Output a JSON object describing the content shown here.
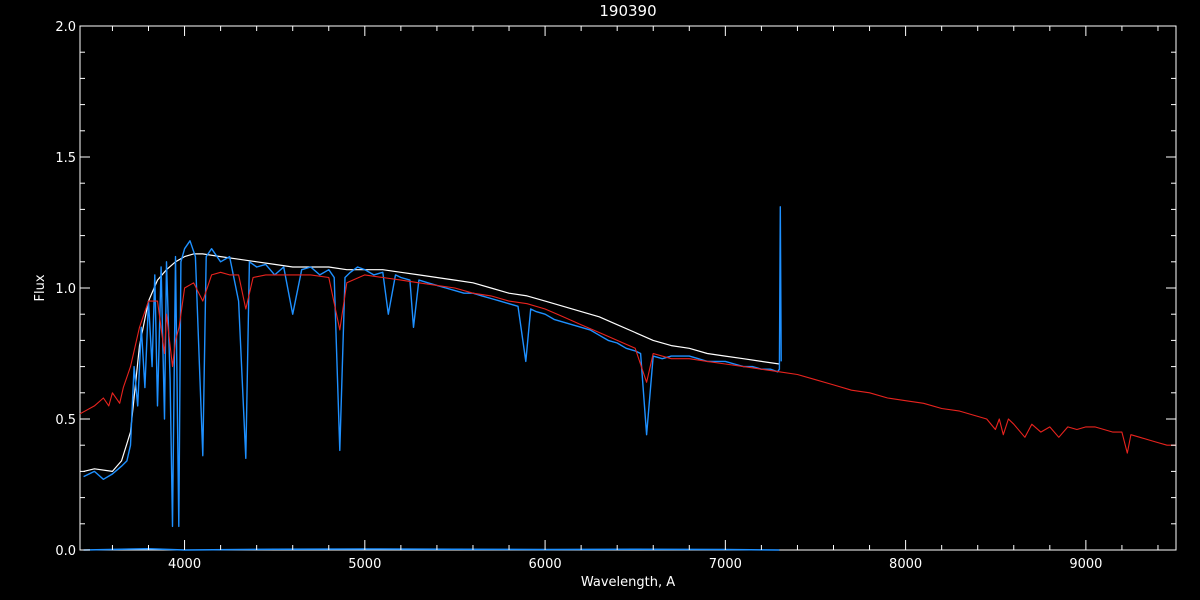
{
  "chart_data": {
    "type": "line",
    "title": "190390",
    "xlabel": "Wavelength, A",
    "ylabel": "Flux",
    "xlim": [
      3420,
      9500
    ],
    "ylim": [
      0.0,
      2.0
    ],
    "x_ticks": [
      4000,
      5000,
      6000,
      7000,
      8000,
      9000
    ],
    "y_ticks": [
      0.0,
      0.5,
      1.0,
      1.5,
      2.0
    ],
    "y_tick_labels": [
      "0.0",
      "0.5",
      "1.0",
      "1.5",
      "2.0"
    ],
    "grid": false,
    "legend": "none",
    "colors": {
      "background": "#000000",
      "axes": "#ffffff",
      "observed": "#ffffff",
      "model": "#1e90ff",
      "reference": "#e8231e",
      "error": "#1e90ff"
    },
    "series": [
      {
        "color": "#ffffff",
        "x": [
          3440,
          3500,
          3600,
          3650,
          3700,
          3750,
          3800,
          3850,
          3900,
          3950,
          4000,
          4050,
          4100,
          4200,
          4300,
          4400,
          4500,
          4600,
          4700,
          4800,
          4900,
          5000,
          5100,
          5200,
          5300,
          5400,
          5500,
          5600,
          5700,
          5800,
          5900,
          6000,
          6100,
          6200,
          6300,
          6400,
          6500,
          6600,
          6700,
          6800,
          6900,
          7000,
          7100,
          7200,
          7300
        ],
        "y": [
          0.3,
          0.31,
          0.3,
          0.34,
          0.45,
          0.78,
          0.95,
          1.03,
          1.07,
          1.1,
          1.12,
          1.13,
          1.13,
          1.12,
          1.11,
          1.1,
          1.09,
          1.08,
          1.08,
          1.08,
          1.07,
          1.07,
          1.07,
          1.06,
          1.05,
          1.04,
          1.03,
          1.02,
          1.0,
          0.98,
          0.97,
          0.95,
          0.93,
          0.91,
          0.89,
          0.86,
          0.83,
          0.8,
          0.78,
          0.77,
          0.75,
          0.74,
          0.73,
          0.72,
          0.71
        ]
      },
      {
        "color": "#1e90ff",
        "x": [
          3440,
          3500,
          3550,
          3600,
          3650,
          3680,
          3700,
          3720,
          3740,
          3760,
          3780,
          3800,
          3820,
          3835,
          3850,
          3870,
          3889,
          3900,
          3920,
          3933,
          3950,
          3968,
          3980,
          4000,
          4030,
          4060,
          4101,
          4120,
          4150,
          4200,
          4250,
          4300,
          4340,
          4360,
          4400,
          4450,
          4500,
          4550,
          4600,
          4650,
          4700,
          4750,
          4800,
          4830,
          4861,
          4890,
          4920,
          4960,
          5000,
          5050,
          5100,
          5130,
          5170,
          5200,
          5250,
          5270,
          5300,
          5350,
          5400,
          5450,
          5500,
          5550,
          5600,
          5650,
          5700,
          5750,
          5800,
          5850,
          5893,
          5920,
          5950,
          6000,
          6050,
          6100,
          6150,
          6200,
          6250,
          6300,
          6350,
          6400,
          6450,
          6500,
          6530,
          6563,
          6600,
          6650,
          6700,
          6750,
          6800,
          6850,
          6900,
          6950,
          7000,
          7050,
          7100,
          7150,
          7200,
          7250,
          7290,
          7300,
          7305,
          7310
        ],
        "y": [
          0.28,
          0.3,
          0.27,
          0.29,
          0.32,
          0.34,
          0.4,
          0.7,
          0.55,
          0.85,
          0.62,
          0.95,
          0.7,
          1.05,
          0.55,
          1.08,
          0.5,
          1.1,
          0.65,
          0.09,
          1.12,
          0.09,
          1.1,
          1.15,
          1.18,
          1.12,
          0.36,
          1.12,
          1.15,
          1.1,
          1.12,
          0.95,
          0.35,
          1.1,
          1.08,
          1.09,
          1.05,
          1.08,
          0.9,
          1.07,
          1.08,
          1.05,
          1.07,
          1.04,
          0.38,
          1.04,
          1.06,
          1.08,
          1.07,
          1.05,
          1.06,
          0.9,
          1.05,
          1.04,
          1.03,
          0.85,
          1.03,
          1.02,
          1.01,
          1.0,
          0.99,
          0.98,
          0.98,
          0.97,
          0.96,
          0.95,
          0.94,
          0.93,
          0.72,
          0.92,
          0.91,
          0.9,
          0.88,
          0.87,
          0.86,
          0.85,
          0.84,
          0.82,
          0.8,
          0.79,
          0.77,
          0.76,
          0.75,
          0.44,
          0.74,
          0.73,
          0.74,
          0.74,
          0.74,
          0.73,
          0.72,
          0.72,
          0.72,
          0.71,
          0.7,
          0.7,
          0.69,
          0.69,
          0.68,
          0.69,
          1.31,
          0.72
        ]
      },
      {
        "color": "#e8231e",
        "x": [
          3420,
          3500,
          3550,
          3580,
          3600,
          3640,
          3660,
          3700,
          3750,
          3800,
          3850,
          3889,
          3900,
          3933,
          3950,
          3970,
          4000,
          4050,
          4101,
          4150,
          4200,
          4250,
          4300,
          4340,
          4380,
          4450,
          4500,
          4600,
          4700,
          4800,
          4861,
          4900,
          5000,
          5100,
          5200,
          5300,
          5400,
          5500,
          5600,
          5700,
          5800,
          5900,
          6000,
          6100,
          6200,
          6300,
          6400,
          6500,
          6563,
          6600,
          6700,
          6800,
          6900,
          7000,
          7100,
          7200,
          7300,
          7400,
          7500,
          7600,
          7700,
          7800,
          7900,
          8000,
          8100,
          8200,
          8300,
          8400,
          8450,
          8498,
          8520,
          8542,
          8570,
          8600,
          8662,
          8700,
          8750,
          8800,
          8850,
          8900,
          8950,
          9000,
          9050,
          9100,
          9150,
          9200,
          9230,
          9250,
          9300,
          9350,
          9400,
          9450,
          9500
        ],
        "y": [
          0.52,
          0.55,
          0.58,
          0.55,
          0.6,
          0.56,
          0.62,
          0.7,
          0.85,
          0.95,
          0.95,
          0.75,
          0.9,
          0.7,
          0.8,
          0.85,
          1.0,
          1.02,
          0.95,
          1.05,
          1.06,
          1.05,
          1.05,
          0.92,
          1.04,
          1.05,
          1.05,
          1.05,
          1.05,
          1.04,
          0.84,
          1.02,
          1.05,
          1.04,
          1.03,
          1.02,
          1.01,
          1.0,
          0.98,
          0.97,
          0.95,
          0.94,
          0.92,
          0.89,
          0.86,
          0.83,
          0.8,
          0.77,
          0.64,
          0.75,
          0.73,
          0.73,
          0.72,
          0.71,
          0.7,
          0.69,
          0.68,
          0.67,
          0.65,
          0.63,
          0.61,
          0.6,
          0.58,
          0.57,
          0.56,
          0.54,
          0.53,
          0.51,
          0.5,
          0.46,
          0.5,
          0.44,
          0.5,
          0.48,
          0.43,
          0.48,
          0.45,
          0.47,
          0.43,
          0.47,
          0.46,
          0.47,
          0.47,
          0.46,
          0.45,
          0.45,
          0.37,
          0.44,
          0.43,
          0.42,
          0.41,
          0.4,
          0.4
        ]
      },
      {
        "color": "#1e90ff",
        "x": [
          3440,
          3800,
          4000,
          4500,
          5000,
          5500,
          6000,
          6500,
          7000,
          7300
        ],
        "y": [
          0.0,
          0.005,
          0.0,
          0.003,
          0.004,
          0.003,
          0.002,
          0.003,
          0.002,
          0.0
        ]
      }
    ]
  }
}
